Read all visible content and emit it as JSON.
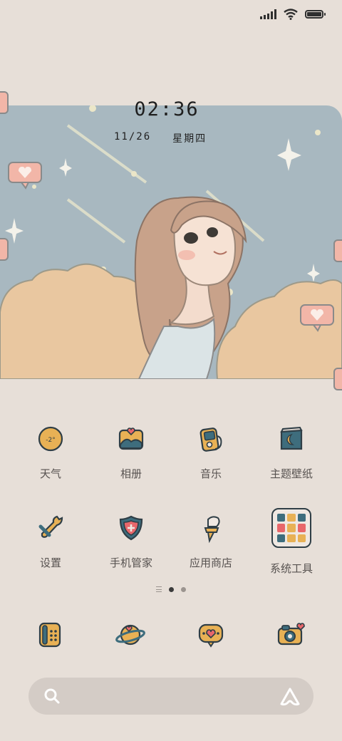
{
  "status_bar": {
    "signal_icon": "cellular-signal-icon",
    "wifi_icon": "wifi-icon",
    "battery_icon": "battery-icon",
    "battery_level": 0.9
  },
  "widget": {
    "time": "02:36",
    "date": "11/26",
    "weekday": "星期四"
  },
  "apps": [
    {
      "label": "天气",
      "icon": "weather-icon",
      "icon_text": "-2°"
    },
    {
      "label": "相册",
      "icon": "gallery-icon"
    },
    {
      "label": "音乐",
      "icon": "music-icon"
    },
    {
      "label": "主题壁纸",
      "icon": "themes-icon"
    },
    {
      "label": "设置",
      "icon": "settings-icon"
    },
    {
      "label": "手机管家",
      "icon": "security-icon"
    },
    {
      "label": "应用商店",
      "icon": "app-store-icon"
    },
    {
      "label": "系统工具",
      "icon": "tools-folder-icon"
    }
  ],
  "page_indicator": {
    "pages": 2,
    "current": 1
  },
  "dock": [
    {
      "icon": "phone-icon"
    },
    {
      "icon": "browser-icon"
    },
    {
      "icon": "messages-icon"
    },
    {
      "icon": "camera-icon"
    }
  ],
  "search_bar": {
    "icon": "search-icon",
    "assistant_icon": "assistant-icon"
  },
  "colors": {
    "background": "#e7dfd8",
    "sky": "#a8b8c0",
    "cloud": "#e9c7a0",
    "accent": "#f0a898",
    "icon_outline": "#2f3e46",
    "icon_yellow": "#e8b155"
  }
}
